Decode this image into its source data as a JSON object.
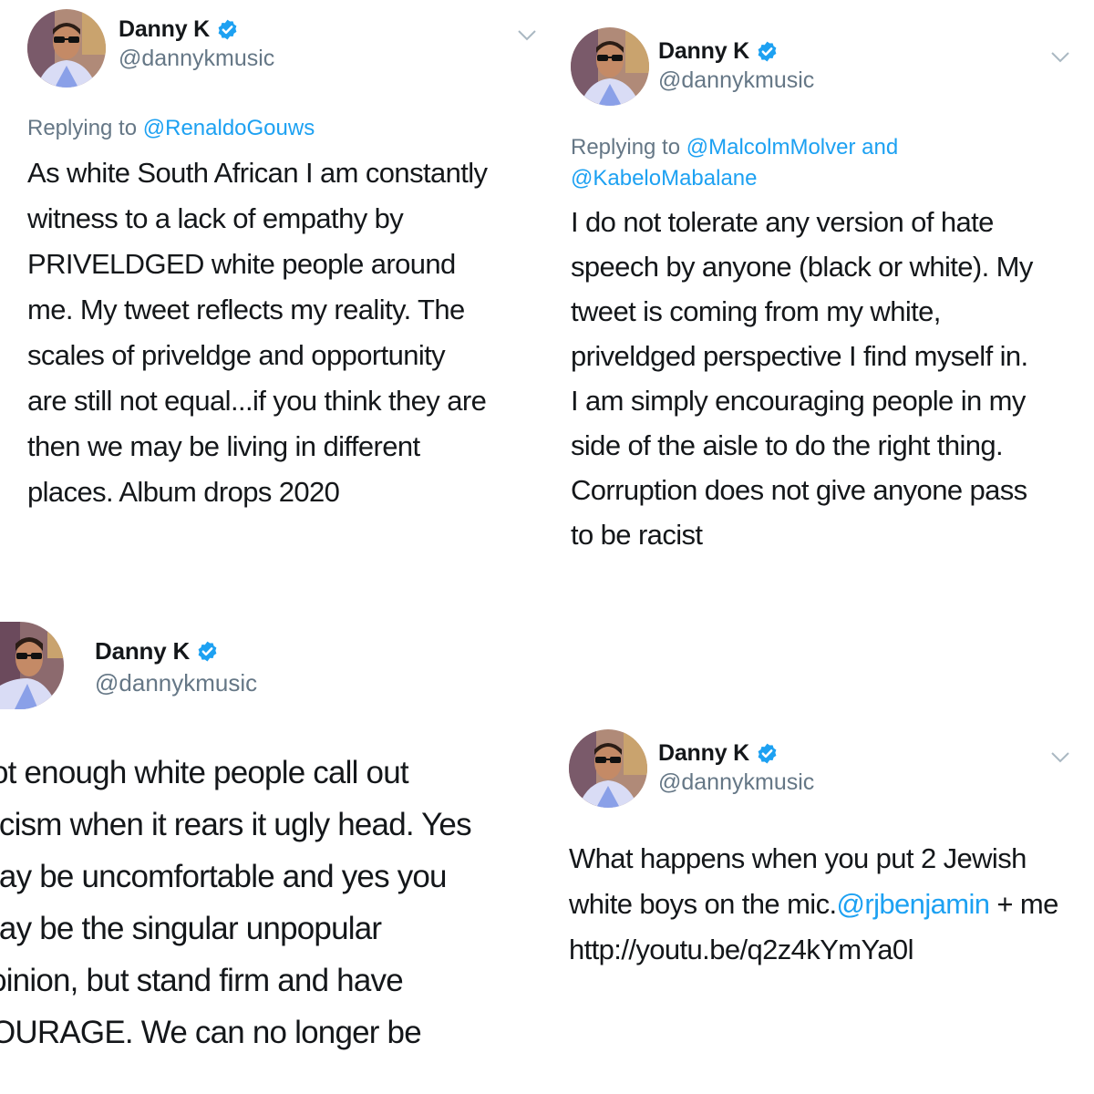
{
  "colors": {
    "text": "#14171a",
    "secondary": "#657786",
    "link": "#1da1f2",
    "verified": "#1da1f2"
  },
  "author": {
    "name": "Danny K",
    "handle": "@dannykmusic",
    "verified_icon": "verified-badge-icon"
  },
  "tweets": [
    {
      "reply_prefix": "Replying to",
      "reply_to": "@RenaldoGouws",
      "lines": [
        "As white South African I am constantly",
        "witness to a lack of empathy by",
        "PRIVELDGED white people around",
        "me. My tweet reflects my reality. The",
        "scales of priveldge and opportunity",
        "are still not equal...if you think they are",
        "then we may be living in different",
        "places. Album drops 2020"
      ]
    },
    {
      "reply_prefix": "Replying to",
      "reply_to_1": "@MalcolmMolver",
      "reply_and": "and",
      "reply_to_2": "@KabeloMabalane",
      "lines": [
        "I do not tolerate any version of hate",
        "speech by anyone (black or white). My",
        "tweet is coming from my white,",
        "priveldged perspective I find myself in.",
        "I am simply encouraging people in my",
        "side of the aisle to do the right thing.",
        "Corruption does not give anyone pass",
        "to be racist"
      ]
    },
    {
      "lines": [
        "ot enough white people call out",
        "ıcism when it rears it ugly head. Yes",
        "ıay be uncomfortable and yes you",
        "ıay be the singular unpopular",
        "ɔinion, but stand firm and have",
        "OURAGE. We can no longer be"
      ]
    },
    {
      "text_before": "What happens when you put 2 Jewish white boys on the mic.",
      "mention": "@rjbenjamin",
      "text_after": " + me http://youtu.be/q2z4kYmYa0l"
    }
  ]
}
